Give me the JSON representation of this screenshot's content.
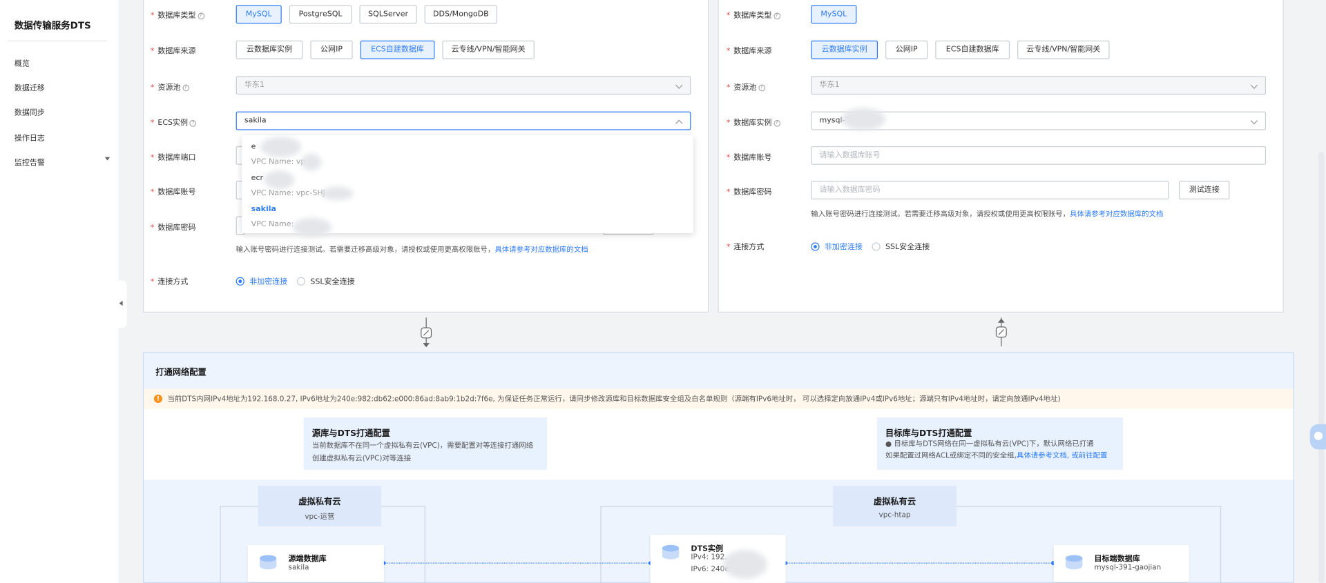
{
  "sidebar": {
    "title": "数据传输服务DTS",
    "items": [
      {
        "label": "概览"
      },
      {
        "label": "数据迁移"
      },
      {
        "label": "数据同步"
      },
      {
        "label": "操作日志"
      },
      {
        "label": "监控告警"
      }
    ]
  },
  "source": {
    "db_type_label": "数据库类型",
    "db_types": [
      "MySQL",
      "PostgreSQL",
      "SQLServer",
      "DDS/MongoDB"
    ],
    "db_type_selected": "MySQL",
    "db_source_label": "数据库来源",
    "db_sources": [
      "云数据库实例",
      "公网IP",
      "ECS自建数据库",
      "云专线/VPN/智能网关"
    ],
    "db_source_selected": "ECS自建数据库",
    "pool_label": "资源池",
    "pool_value": "华东1",
    "ecs_label": "ECS实例",
    "ecs_value": "sakila",
    "port_label": "数据库端口",
    "account_label": "数据库账号",
    "password_label": "数据库密码",
    "hint_text": "输入账号密码进行连接测试。若需要迁移高级对象，请授权或使用更高权限账号，",
    "hint_link": "具体请参考对应数据库的文档",
    "conn_label": "连接方式",
    "conn_options": [
      "非加密连接",
      "SSL安全连接"
    ],
    "dropdown": [
      {
        "name": "e",
        "vpc": "VPC Name: vp"
      },
      {
        "name": "ecr",
        "vpc": "VPC Name: vpc-SHJ"
      },
      {
        "name": "sakila",
        "vpc": "VPC Name:"
      }
    ]
  },
  "target": {
    "db_type_label": "数据库类型",
    "db_types": [
      "MySQL"
    ],
    "db_source_label": "数据库来源",
    "db_sources": [
      "云数据库实例",
      "公网IP",
      "ECS自建数据库",
      "云专线/VPN/智能网关"
    ],
    "db_source_selected": "云数据库实例",
    "pool_label": "资源池",
    "pool_value": "华东1",
    "instance_label": "数据库实例",
    "instance_value": "mysql-",
    "account_label": "数据库账号",
    "account_placeholder": "请输入数据库账号",
    "password_label": "数据库密码",
    "password_placeholder": "请输入数据库密码",
    "test_button": "测试连接",
    "hint_text": "输入账号密码进行连接测试。若需要迁移高级对象，请授权或使用更高权限账号，",
    "hint_link": "具体请参考对应数据库的文档",
    "conn_label": "连接方式",
    "conn_options": [
      "非加密连接",
      "SSL安全连接"
    ]
  },
  "network": {
    "title": "打通网络配置",
    "warning": "当前DTS内网IPv4地址为192.168.0.27, IPv6地址为240e:982:db62:e000:86ad:8ab9:1b2d:7f6e, 为保证任务正常运行，请同步修改源库和目标数据库安全组及白名单规则（源端有IPv6地址时， 可以选择定向放通IPv4或IPv6地址；源端只有IPv4地址时，请定向放通IPv4地址)",
    "src_card": {
      "title": "源库与DTS打通配置",
      "line1": "当前数据库不在同一个虚拟私有云(VPC)，需要配置对等连接打通网络",
      "link": "创建虚拟私有云(VPC)对等连接"
    },
    "dst_card": {
      "title": "目标库与DTS打通配置",
      "line1": "● 目标库与DTS网络在同一虚拟私有云(VPC)下，默认网络已打通",
      "line2": "如果配置过网络ACL或绑定不同的安全组,",
      "link": "具体请参考文档, 或前往配置"
    },
    "vpc_left": {
      "title": "虚拟私有云",
      "name": "vpc-运营"
    },
    "vpc_right": {
      "title": "虚拟私有云",
      "name": "vpc-htap"
    },
    "src_node": {
      "title": "源端数据库",
      "sub": "sakila"
    },
    "dts_node": {
      "title": "DTS实例",
      "ipv4": "IPv4: 192.",
      "ipv6": "IPv6: 240e:"
    },
    "dst_node": {
      "title": "目标端数据库",
      "sub": "mysql-391-gaojian"
    }
  },
  "colors": {
    "accent": "#2f7cf6",
    "warning": "#f7941d",
    "required": "#e54545"
  }
}
